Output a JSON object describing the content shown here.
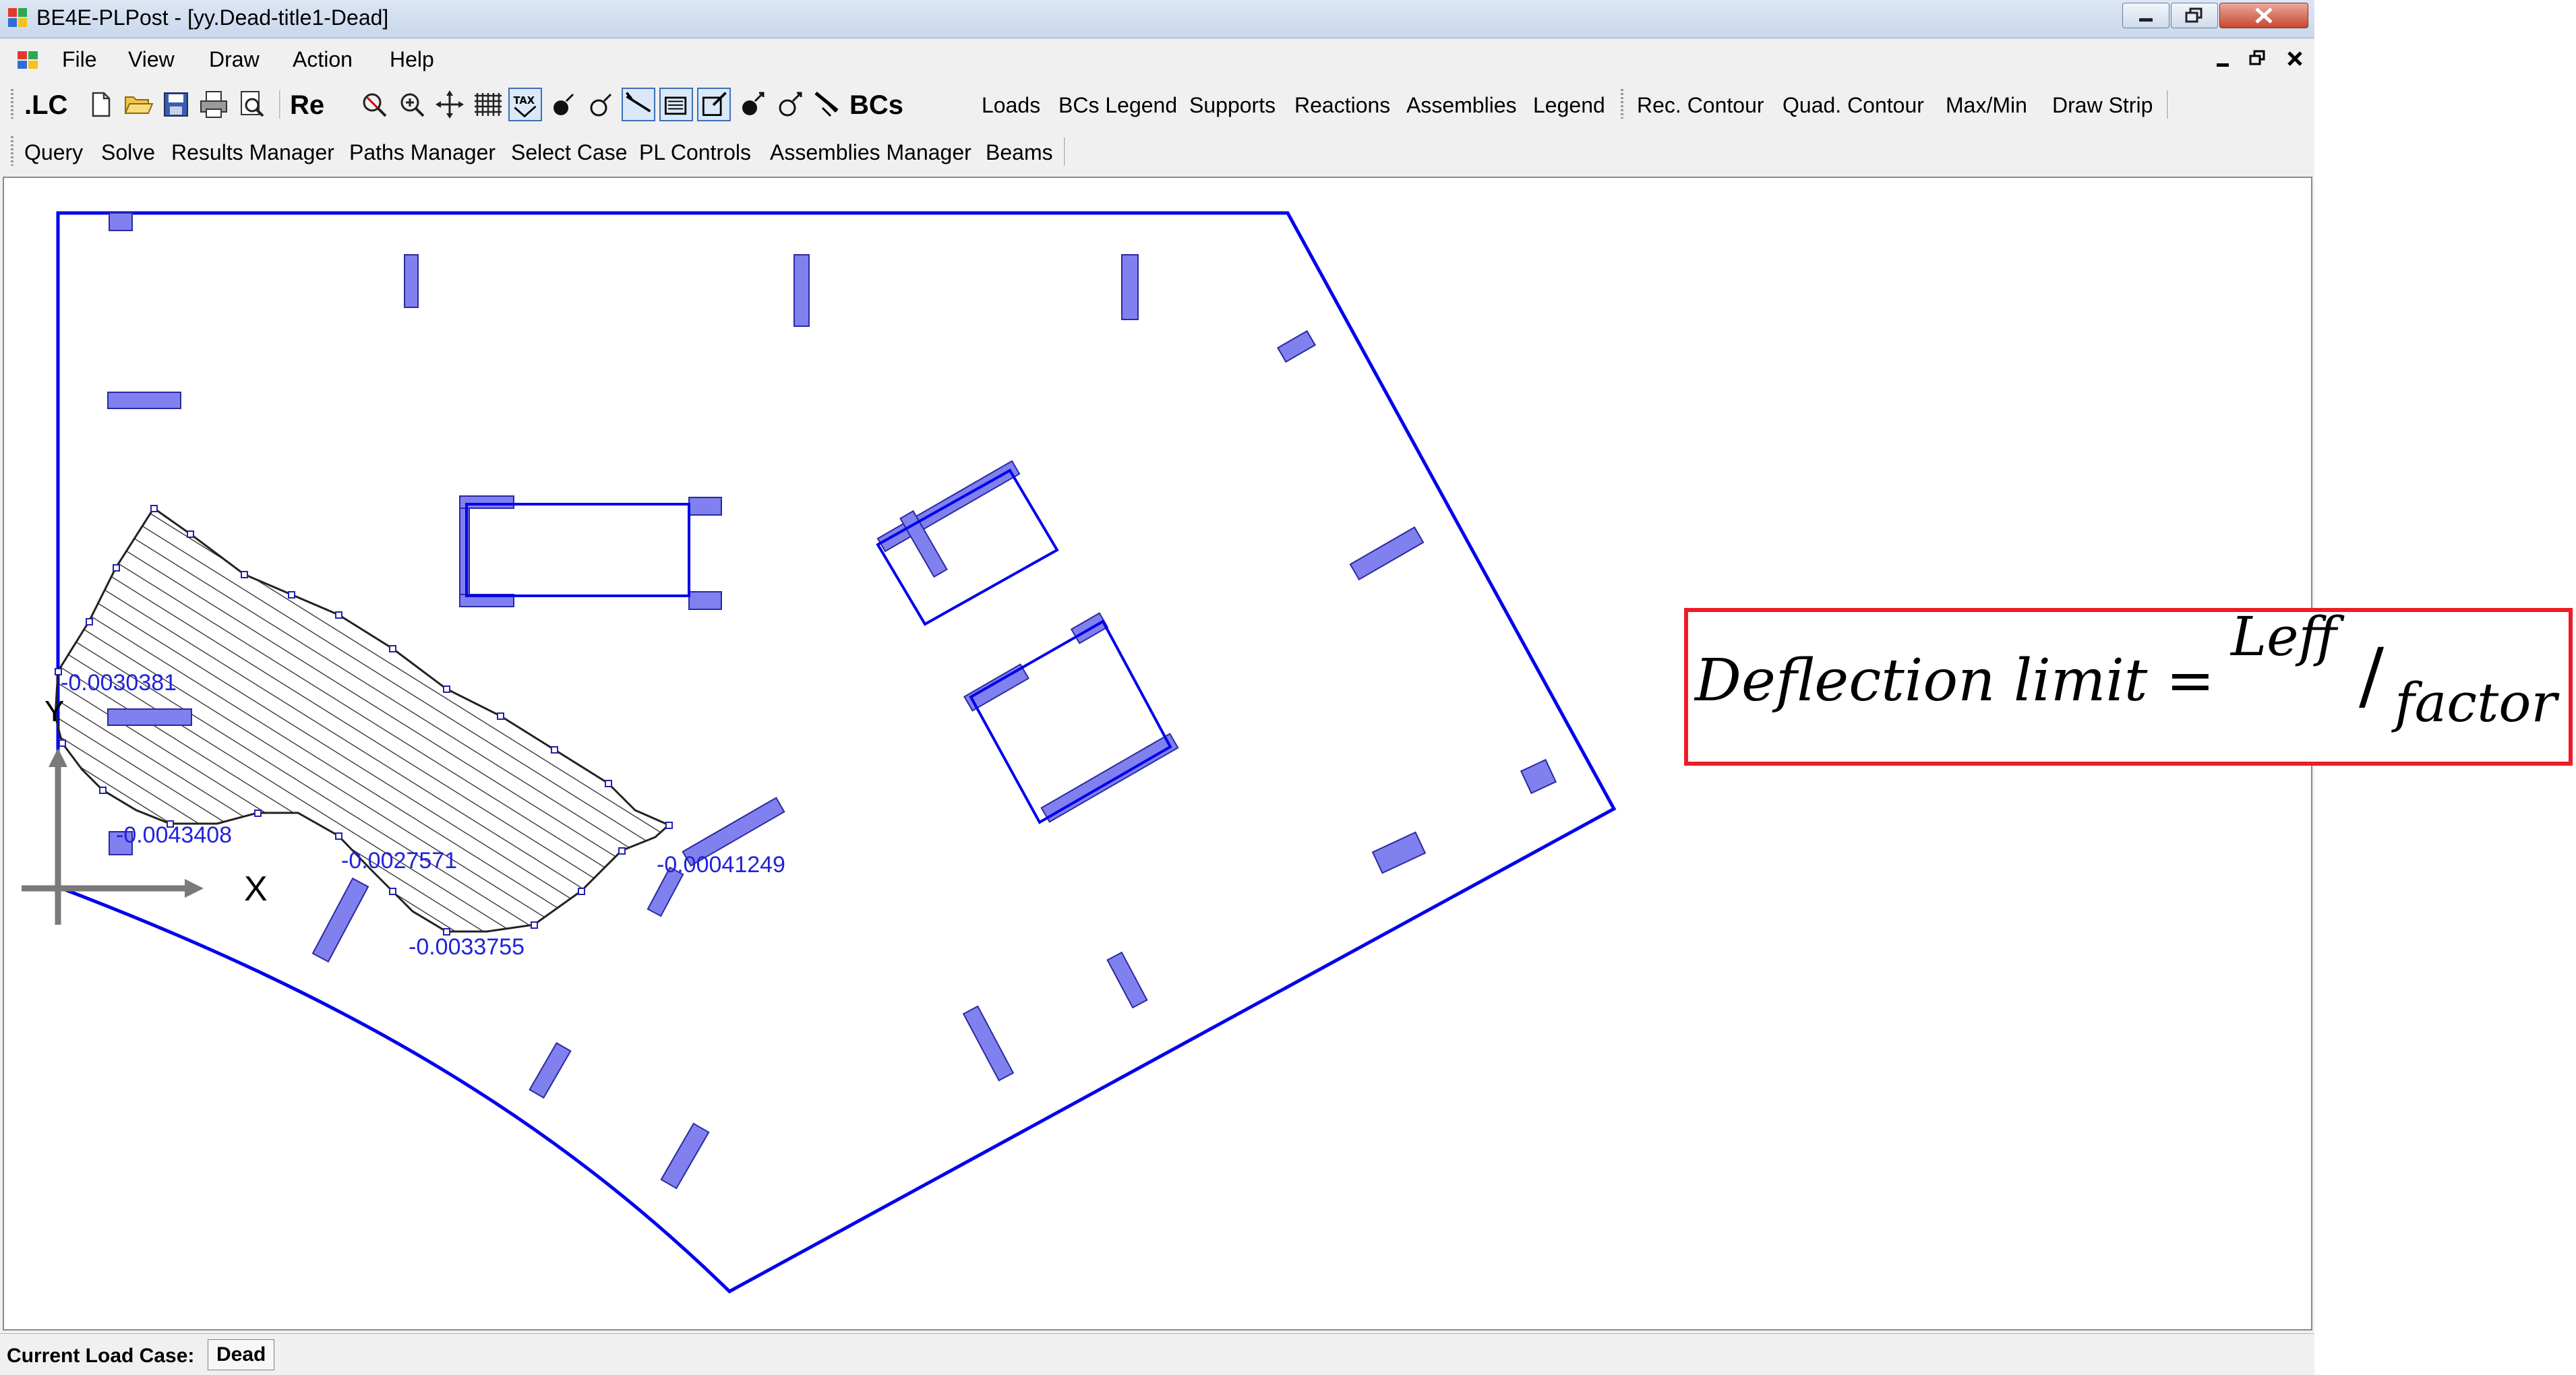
{
  "window": {
    "title": "BE4E-PLPost - [yy.Dead-title1-Dead]"
  },
  "menu": {
    "items": [
      "File",
      "View",
      "Draw",
      "Action",
      "Help"
    ]
  },
  "toolbar1": {
    "lc_label": ".LC",
    "re_label": "Re",
    "bcs_label": "BCs",
    "text_buttons": [
      "Loads",
      "BCs Legend",
      "Supports",
      "Reactions",
      "Assemblies",
      "Legend"
    ],
    "contour_buttons": [
      "Rec. Contour",
      "Quad. Contour",
      "Max/Min",
      "Draw Strip"
    ]
  },
  "toolbar2": {
    "buttons": [
      "Query",
      "Solve",
      "Results Manager",
      "Paths Manager",
      "Select Case",
      "PL Controls",
      "Assemblies Manager",
      "Beams"
    ]
  },
  "plot": {
    "values": [
      "-0.0030381",
      "-0.0043408",
      "-0.0027571",
      "-0.0033755",
      "-0.00041249"
    ],
    "x_axis_label": "X",
    "y_axis_label": "Y",
    "outline_color": "#0000ee",
    "element_fill": "#8080ee",
    "value_color": "#2222dd"
  },
  "status": {
    "label": "Current Load Case:",
    "value": "Dead"
  },
  "formula": {
    "lhs": "Deflection limit",
    "equals": "=",
    "numerator": "Leff",
    "slash": "/",
    "denominator": "factor",
    "border_color": "#ee1c25"
  }
}
